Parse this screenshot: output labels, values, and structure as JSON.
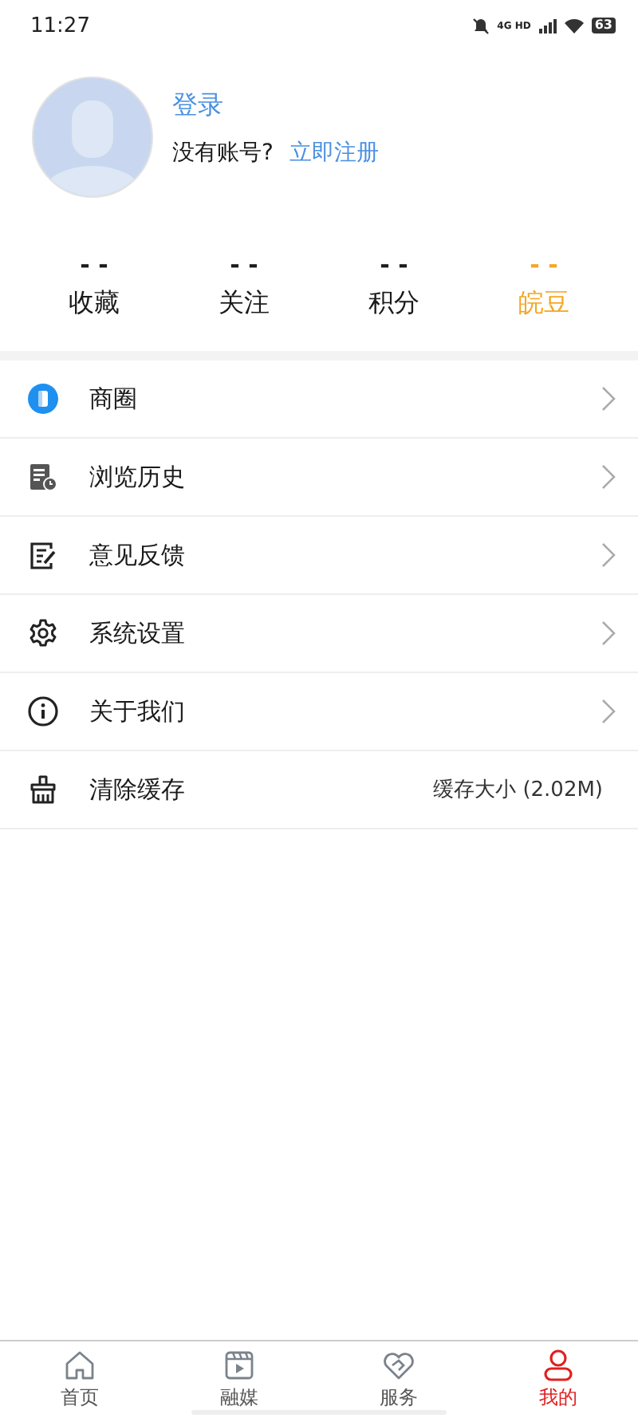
{
  "status_bar": {
    "time": "11:27",
    "network": "4G HD",
    "battery": "63"
  },
  "profile": {
    "login": "登录",
    "prompt": "没有账号?",
    "register": "立即注册"
  },
  "stats": [
    {
      "value": "- -",
      "label": "收藏",
      "color": "#1a1a1a"
    },
    {
      "value": "- -",
      "label": "关注",
      "color": "#1a1a1a"
    },
    {
      "value": "- -",
      "label": "积分",
      "color": "#1a1a1a"
    },
    {
      "value": "- -",
      "label": "皖豆",
      "color": "#f5a623"
    }
  ],
  "menu": [
    {
      "label": "商圈",
      "kind": "link"
    },
    {
      "label": "浏览历史",
      "kind": "link"
    },
    {
      "label": "意见反馈",
      "kind": "link"
    },
    {
      "label": "系统设置",
      "kind": "link"
    },
    {
      "label": "关于我们",
      "kind": "link"
    },
    {
      "label": "清除缓存",
      "kind": "value",
      "value": "缓存大小 (2.02M)"
    }
  ],
  "tabs": [
    {
      "label": "首页",
      "selected": false
    },
    {
      "label": "融媒",
      "selected": false
    },
    {
      "label": "服务",
      "selected": false
    },
    {
      "label": "我的",
      "selected": true
    }
  ]
}
